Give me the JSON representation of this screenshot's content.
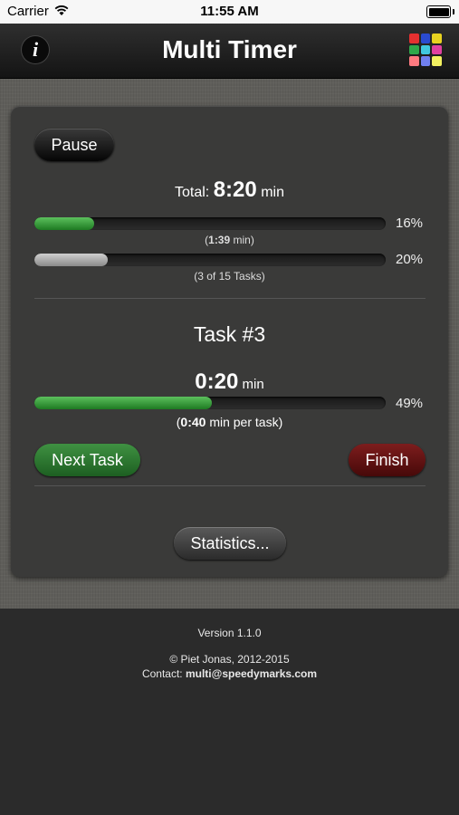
{
  "status_bar": {
    "carrier": "Carrier",
    "time": "11:55 AM"
  },
  "nav": {
    "title": "Multi Timer",
    "info_icon": "info-icon",
    "grid_icon": "color-grid-icon",
    "grid_colors": [
      "#e53030",
      "#2a4bd0",
      "#e8d220",
      "#2fa84a",
      "#40c8e0",
      "#e040a0",
      "#ff7a80",
      "#7080f0",
      "#f2f060"
    ]
  },
  "controls": {
    "pause_label": "Pause",
    "next_label": "Next Task",
    "finish_label": "Finish",
    "stats_label": "Statistics..."
  },
  "total": {
    "prefix": "Total:",
    "value": "8:20",
    "unit": "min"
  },
  "progress_time": {
    "percent_label": "16%",
    "fraction": 0.17,
    "sub_open": "(",
    "sub_value": "1:39",
    "sub_close": " min)"
  },
  "progress_tasks": {
    "percent_label": "20%",
    "fraction": 0.21,
    "sub": "(3 of 15 Tasks)"
  },
  "task": {
    "title": "Task #3",
    "value": "0:20",
    "unit": "min",
    "percent_label": "49%",
    "fraction": 0.505,
    "sub_open": "(",
    "sub_value": "0:40",
    "sub_close": " min per task)"
  },
  "footer": {
    "version": "Version 1.1.0",
    "copyright": "© Piet Jonas, 2012-2015",
    "contact_prefix": "Contact: ",
    "contact_email": "multi@speedymarks.com"
  }
}
